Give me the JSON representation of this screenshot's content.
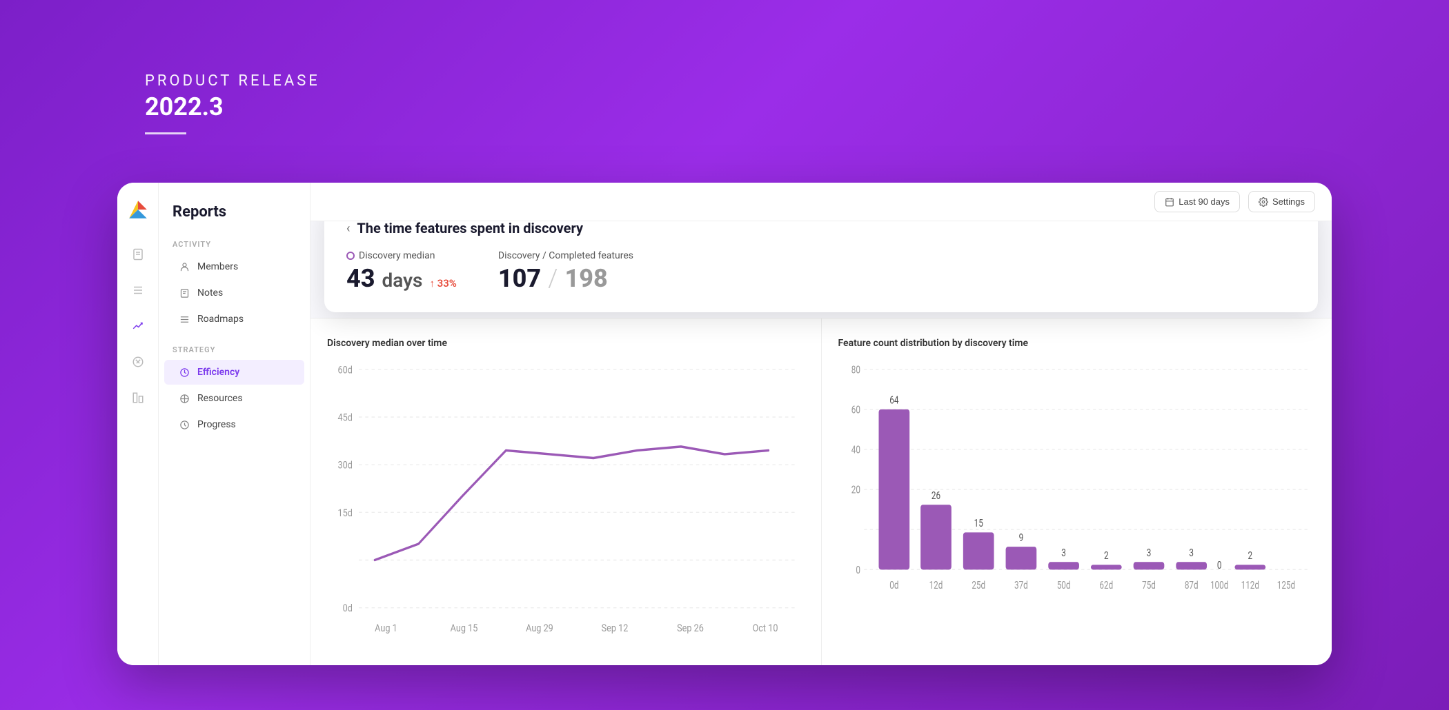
{
  "header": {
    "label": "PRODUCT RELEASE",
    "version": "2022.3"
  },
  "topbar": {
    "date_range_label": "Last 90 days",
    "settings_label": "Settings"
  },
  "sidebar": {
    "title": "Reports",
    "sections": [
      {
        "name": "ACTIVITY",
        "items": [
          {
            "id": "members",
            "label": "Members",
            "icon": "person"
          },
          {
            "id": "notes",
            "label": "Notes",
            "icon": "doc"
          },
          {
            "id": "roadmaps",
            "label": "Roadmaps",
            "icon": "list"
          }
        ]
      },
      {
        "name": "STRATEGY",
        "items": [
          {
            "id": "efficiency",
            "label": "Efficiency",
            "icon": "circle-arrow",
            "active": true
          },
          {
            "id": "resources",
            "label": "Resources",
            "icon": "snowflake"
          },
          {
            "id": "progress",
            "label": "Progress",
            "icon": "clock"
          }
        ]
      }
    ]
  },
  "popup": {
    "back_label": "‹",
    "title": "The time features spent in discovery",
    "metrics": [
      {
        "id": "discovery_median",
        "label": "Discovery median",
        "value": "43",
        "unit": "days",
        "change": "↑ 33%",
        "has_dot": true
      },
      {
        "id": "discovery_completed",
        "label": "Discovery / Completed features",
        "numerator": "107",
        "denominator": "198",
        "has_dot": false
      }
    ]
  },
  "charts": [
    {
      "id": "line_chart",
      "title": "Discovery median over time",
      "y_labels": [
        "60d",
        "45d",
        "30d",
        "15d",
        "0d"
      ],
      "x_labels": [
        "Aug 1",
        "Aug 15",
        "Aug 29",
        "Sep 12",
        "Sep 26",
        "Oct 10"
      ],
      "data_points": [
        14,
        18,
        32,
        44,
        43,
        42,
        44,
        45,
        43,
        44,
        44
      ]
    },
    {
      "id": "bar_chart",
      "title": "Feature count distribution by discovery time",
      "y_labels": [
        "80",
        "60",
        "40",
        "20",
        "0"
      ],
      "x_labels": [
        "0d",
        "12d",
        "25d",
        "37d",
        "50d",
        "62d",
        "75d",
        "87d",
        "100d",
        "112d",
        "125d"
      ],
      "bars": [
        {
          "label": "64",
          "value": 64
        },
        {
          "label": "26",
          "value": 26
        },
        {
          "label": "15",
          "value": 15
        },
        {
          "label": "9",
          "value": 9
        },
        {
          "label": "3",
          "value": 3
        },
        {
          "label": "2",
          "value": 2
        },
        {
          "label": "3",
          "value": 3
        },
        {
          "label": "3",
          "value": 3
        },
        {
          "label": "0",
          "value": 0
        },
        {
          "label": "2",
          "value": 2
        }
      ]
    }
  ],
  "colors": {
    "brand_purple": "#8b2fc9",
    "accent_purple": "#9b59b6",
    "active_nav": "#7c3aed",
    "bg_purple": "#8e24c9"
  }
}
